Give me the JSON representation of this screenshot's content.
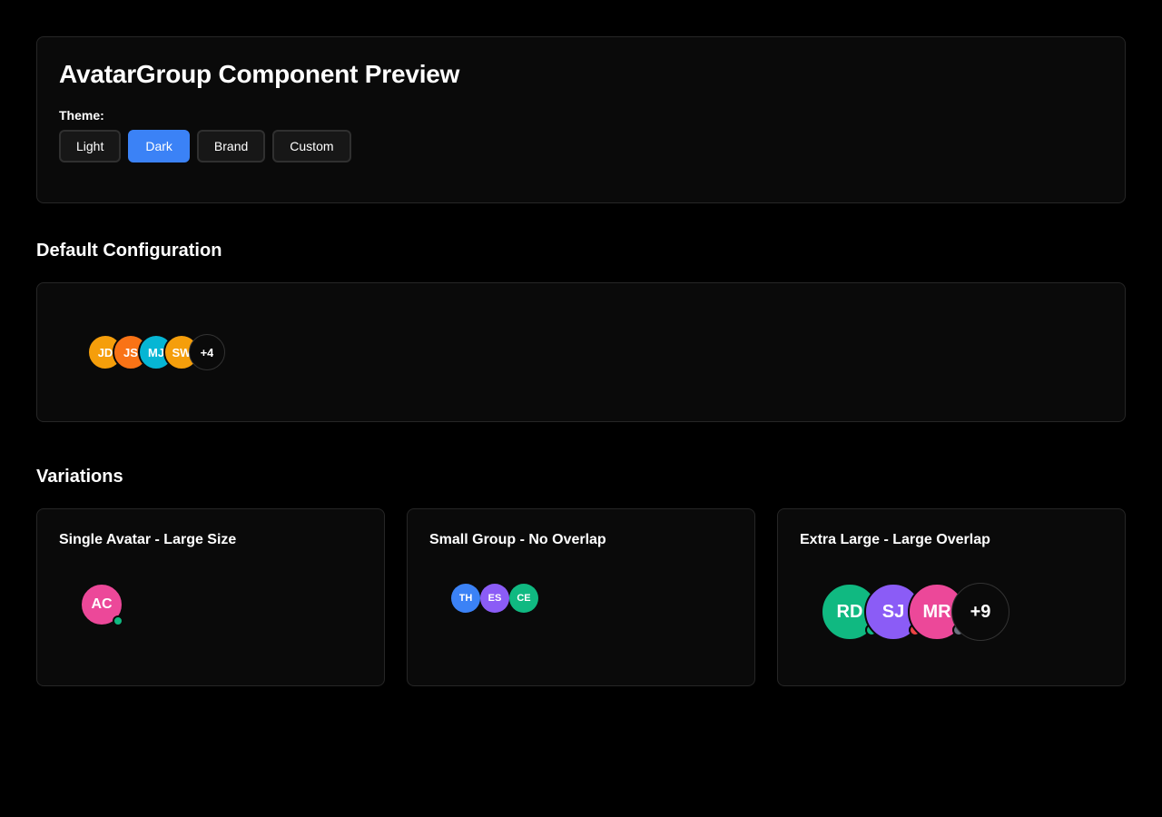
{
  "header": {
    "title": "AvatarGroup Component Preview",
    "theme_label": "Theme:",
    "themes": [
      {
        "label": "Light",
        "active": false
      },
      {
        "label": "Dark",
        "active": true
      },
      {
        "label": "Brand",
        "active": false
      },
      {
        "label": "Custom",
        "active": false
      }
    ]
  },
  "default_section": {
    "title": "Default Configuration",
    "avatars": [
      {
        "initials": "JD",
        "color": "#f59e0b"
      },
      {
        "initials": "JS",
        "color": "#f97316"
      },
      {
        "initials": "MJ",
        "color": "#06b6d4"
      },
      {
        "initials": "SW",
        "color": "#f59e0b"
      }
    ],
    "overflow": "+4"
  },
  "variations_section": {
    "title": "Variations",
    "cards": [
      {
        "title": "Single Avatar - Large Size",
        "avatars": [
          {
            "initials": "AC",
            "color": "#ec4899",
            "status_color": "#10b981"
          }
        ]
      },
      {
        "title": "Small Group - No Overlap",
        "avatars": [
          {
            "initials": "TH",
            "color": "#3b82f6"
          },
          {
            "initials": "ES",
            "color": "#8b5cf6"
          },
          {
            "initials": "CE",
            "color": "#10b981"
          }
        ]
      },
      {
        "title": "Extra Large - Large Overlap",
        "avatars": [
          {
            "initials": "RD",
            "color": "#10b981",
            "status_color": "#10b981"
          },
          {
            "initials": "SJ",
            "color": "#8b5cf6",
            "status_color": "#ef4444"
          },
          {
            "initials": "MR",
            "color": "#ec4899",
            "status_color": "#6b7280"
          }
        ],
        "overflow": "+9"
      }
    ]
  }
}
